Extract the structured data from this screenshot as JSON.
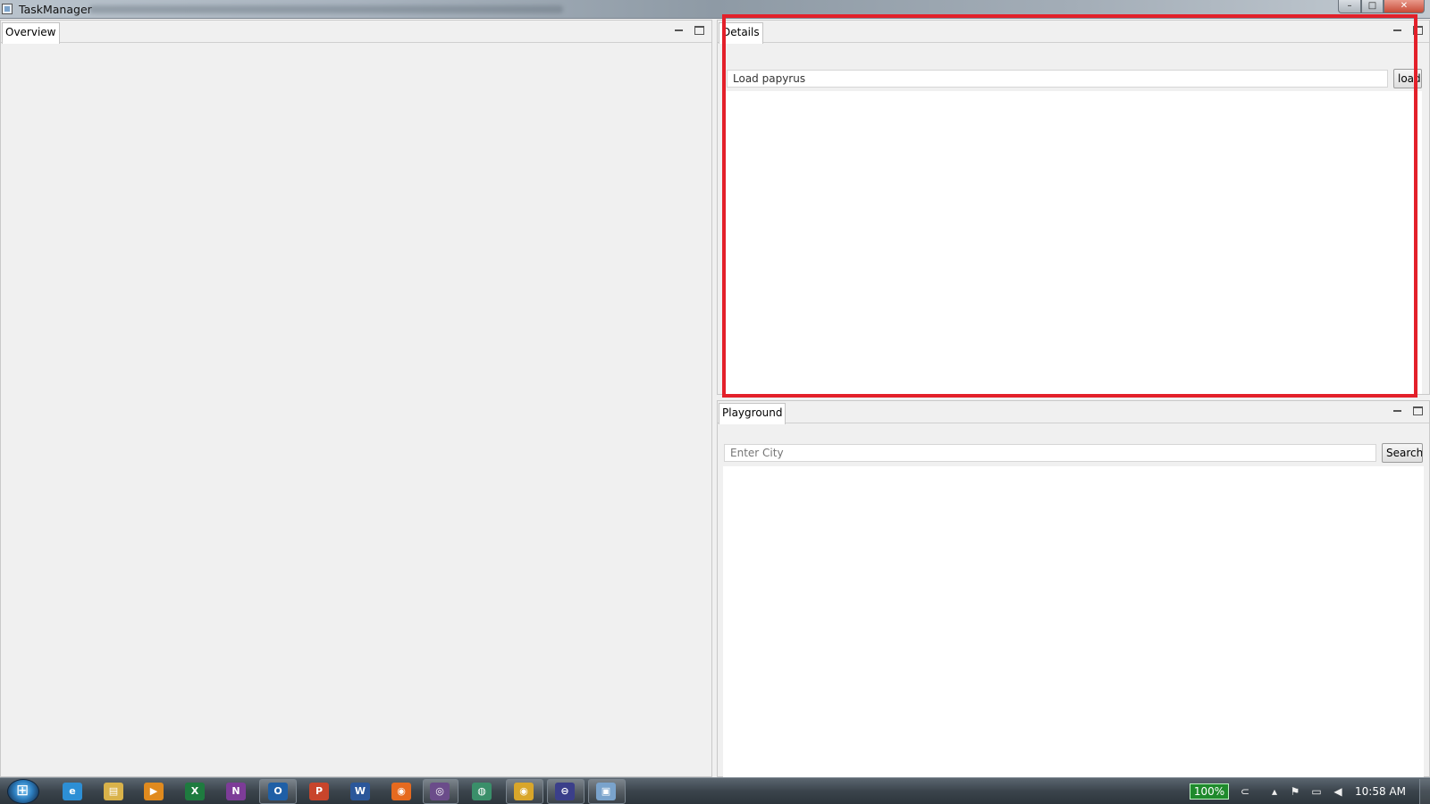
{
  "window": {
    "title": "TaskManager",
    "buttons": {
      "minimize": "–",
      "maximize": "□",
      "close": "✕"
    }
  },
  "overview": {
    "tab_label": "Overview"
  },
  "details": {
    "tab_label": "Details",
    "input_value": "Load papyrus",
    "load_button_label": "load"
  },
  "playground": {
    "tab_label": "Playground",
    "input_placeholder": "Enter City",
    "search_button_label": "Search"
  },
  "taskbar": {
    "icons": [
      {
        "name": "internet-explorer-icon",
        "glyph": "e",
        "color": "#2d8fd5"
      },
      {
        "name": "file-explorer-icon",
        "glyph": "▤",
        "color": "#d9b24a"
      },
      {
        "name": "media-player-icon",
        "glyph": "▶",
        "color": "#e08a1e"
      },
      {
        "name": "excel-icon",
        "glyph": "X",
        "color": "#1e7b3f"
      },
      {
        "name": "onenote-icon",
        "glyph": "N",
        "color": "#7d3c98"
      },
      {
        "name": "outlook-icon",
        "glyph": "O",
        "color": "#1f5fa6"
      },
      {
        "name": "powerpoint-icon",
        "glyph": "P",
        "color": "#c8452b"
      },
      {
        "name": "word-icon",
        "glyph": "W",
        "color": "#2b579a"
      },
      {
        "name": "firefox-icon",
        "glyph": "◉",
        "color": "#e66a1f"
      },
      {
        "name": "eclipse-icon",
        "glyph": "◎",
        "color": "#6b4c8a"
      },
      {
        "name": "network-icon",
        "glyph": "◍",
        "color": "#3a8f6a"
      },
      {
        "name": "chrome-icon",
        "glyph": "◉",
        "color": "#d9a62a"
      },
      {
        "name": "eclipse-ide-icon",
        "glyph": "⊖",
        "color": "#3b3f8a"
      },
      {
        "name": "taskmanager-app-icon",
        "glyph": "▣",
        "color": "#7aa3cc"
      }
    ],
    "battery_percent": "100%",
    "clock": "10:58 AM"
  }
}
